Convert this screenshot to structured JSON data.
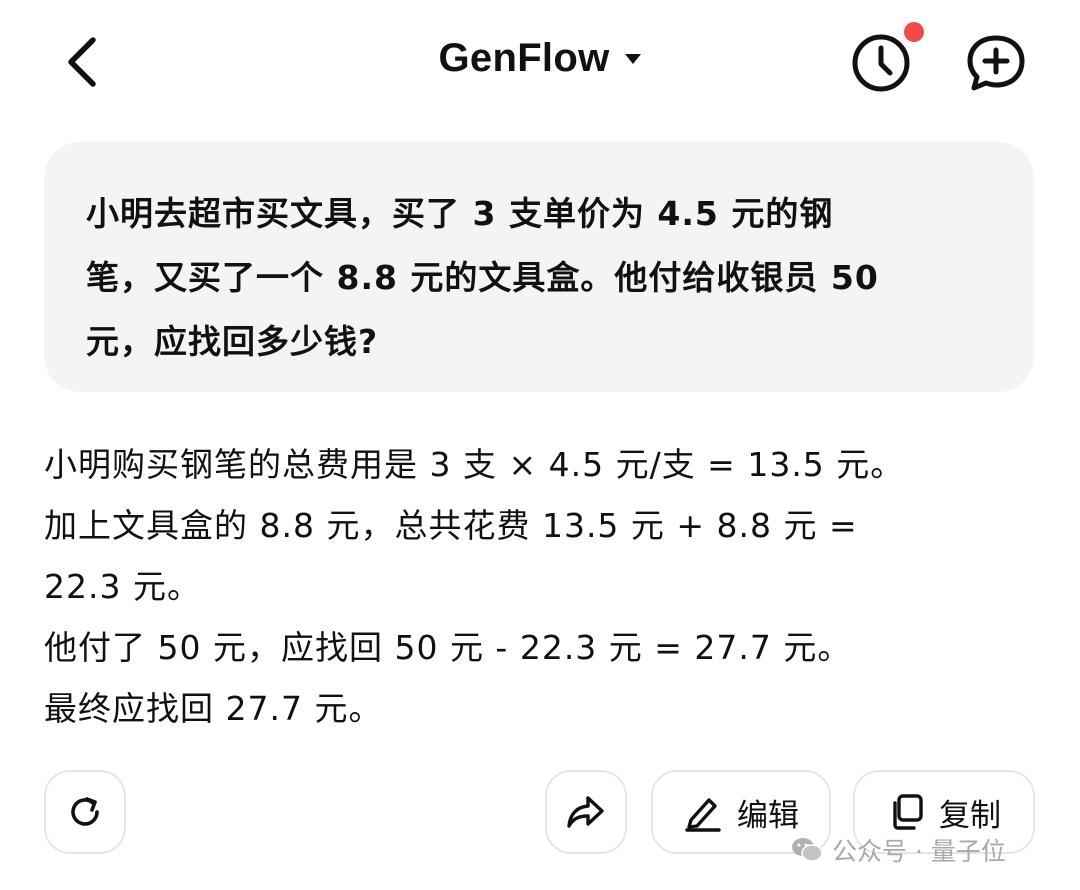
{
  "header": {
    "title": "GenFlow"
  },
  "user_message": {
    "lines": [
      "小明去超市买文具，买了 3 支单价为 4.5 元的钢",
      "笔，又买了一个 8.8 元的文具盒。他付给收银员 50",
      "元，应找回多少钱?"
    ]
  },
  "answer": {
    "lines": [
      "小明购买钢笔的总费用是 3 支 × 4.5 元/支 = 13.5 元。",
      "加上文具盒的 8.8 元，总共花费 13.5 元 + 8.8 元 =",
      "22.3 元。",
      "他付了 50 元，应找回 50 元 - 22.3 元 = 27.7 元。",
      "最终应找回 27.7 元。"
    ]
  },
  "actions": {
    "edit_label": "编辑",
    "copy_label": "复制"
  },
  "watermark": {
    "text": "公众号 · 量子位"
  },
  "colors": {
    "notification_dot": "#f04a4a",
    "bubble_bg": "#f4f4f6",
    "button_border": "#e6e6e8",
    "watermark_text": "#a8a8ac"
  },
  "icons": [
    "back-arrow-icon",
    "caret-down-icon",
    "clock-history-icon",
    "chat-plus-icon",
    "refresh-icon",
    "share-arrow-icon",
    "pencil-icon",
    "copy-icon",
    "wechat-icon"
  ]
}
